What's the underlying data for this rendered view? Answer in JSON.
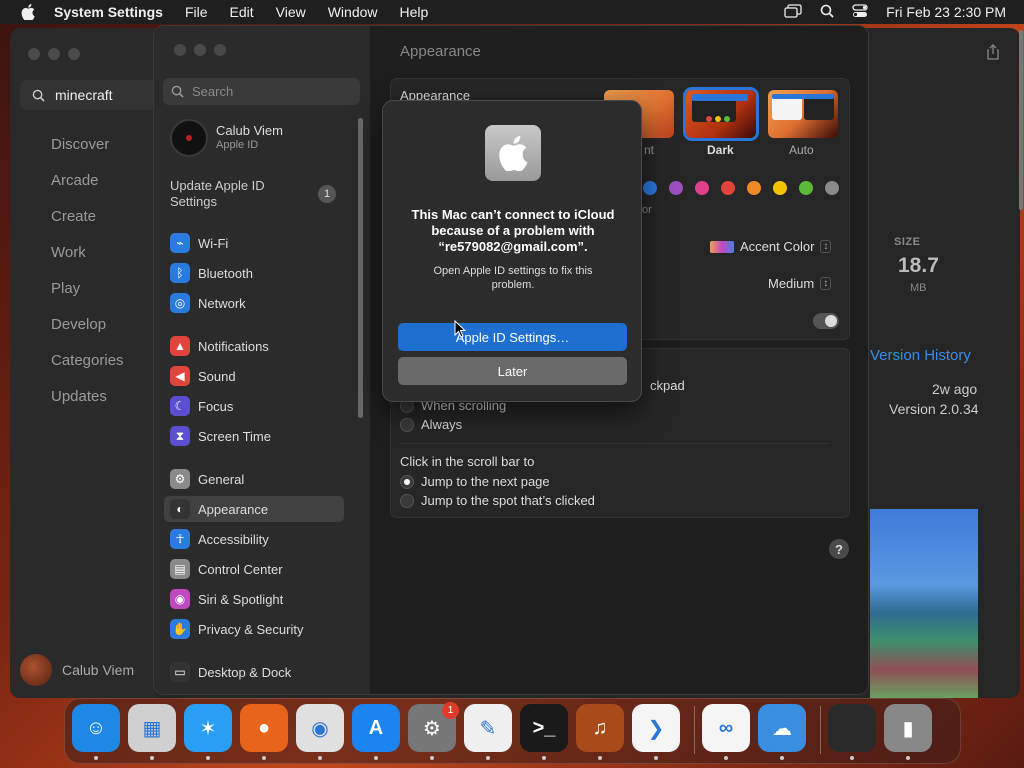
{
  "menubar": {
    "app_name": "System Settings",
    "menus": [
      "File",
      "Edit",
      "View",
      "Window",
      "Help"
    ],
    "datetime": "Fri Feb 23  2:30 PM"
  },
  "app_store": {
    "search_value": "minecraft",
    "nav": [
      "Discover",
      "Arcade",
      "Create",
      "Work",
      "Play",
      "Develop",
      "Categories",
      "Updates"
    ],
    "user_name": "Calub Viem",
    "size_label": "SIZE",
    "size_value": "18.7",
    "size_unit": "MB",
    "version_history": "Version History",
    "updated_ago": "2w ago",
    "version": "Version 2.0.34"
  },
  "settings": {
    "search_placeholder": "Search",
    "user": {
      "name": "Calub Viem",
      "subtitle": "Apple ID"
    },
    "update_prompt": "Update Apple ID Settings",
    "update_count": "1",
    "sidebar_groups": [
      [
        {
          "label": "Wi-Fi",
          "icon": "wifi-icon",
          "color": "#2a7be0"
        },
        {
          "label": "Bluetooth",
          "icon": "bluetooth-icon",
          "color": "#2a7be0"
        },
        {
          "label": "Network",
          "icon": "globe-icon",
          "color": "#2a7be0"
        }
      ],
      [
        {
          "label": "Notifications",
          "icon": "bell-icon",
          "color": "#e0443a"
        },
        {
          "label": "Sound",
          "icon": "speaker-icon",
          "color": "#e0443a"
        },
        {
          "label": "Focus",
          "icon": "moon-icon",
          "color": "#5a4fd0"
        },
        {
          "label": "Screen Time",
          "icon": "hourglass-icon",
          "color": "#5a4fd0"
        }
      ],
      [
        {
          "label": "General",
          "icon": "gear-icon",
          "color": "#8a8a8a"
        },
        {
          "label": "Appearance",
          "icon": "appearance-icon",
          "color": "#333333",
          "active": true
        },
        {
          "label": "Accessibility",
          "icon": "accessibility-icon",
          "color": "#2a7be0"
        },
        {
          "label": "Control Center",
          "icon": "control-center-icon",
          "color": "#8a8a8a"
        },
        {
          "label": "Siri & Spotlight",
          "icon": "siri-icon",
          "color": "#c048c0"
        },
        {
          "label": "Privacy & Security",
          "icon": "hand-icon",
          "color": "#2a7be0"
        }
      ],
      [
        {
          "label": "Desktop & Dock",
          "icon": "dock-icon",
          "color": "#333333"
        }
      ]
    ],
    "page_title": "Appearance",
    "appearance_label": "Appearance",
    "themes": [
      "Light",
      "Dark",
      "Auto"
    ],
    "selected_theme": "Dark",
    "accent_colors": [
      "#2a7be0",
      "#9b4fc0",
      "#e0408a",
      "#e0443a",
      "#f08a24",
      "#f2c200",
      "#5ab83a",
      "#8a8a8a"
    ],
    "highlight_value": "Accent Color",
    "sidebar_icon_size_value": "Medium",
    "scroll_option_fragment": "ckpad",
    "show_scroll_options": [
      "When scrolling",
      "Always"
    ],
    "click_scroll_label": "Click in the scroll bar to",
    "click_scroll_options": [
      "Jump to the next page",
      "Jump to the spot that’s clicked"
    ],
    "help_label": "?"
  },
  "dialog": {
    "title": "This Mac can’t connect to iCloud because of a problem with “re579082@gmail.com”.",
    "body": "Open Apple ID settings to fix this problem.",
    "primary_label": "Apple ID Settings…",
    "secondary_label": "Later",
    "light_partial": "nt",
    "accent_partial": "or"
  },
  "dock": {
    "items": [
      {
        "name": "finder",
        "color": "#1e88e5",
        "glyph": "☺"
      },
      {
        "name": "launchpad",
        "color": "#d0d0d0",
        "glyph": "▦"
      },
      {
        "name": "safari",
        "color": "#2a9df4",
        "glyph": "✶"
      },
      {
        "name": "firefox",
        "color": "#e8641b",
        "glyph": "●"
      },
      {
        "name": "chrome",
        "color": "#e0e0e0",
        "glyph": "◉"
      },
      {
        "name": "app-store",
        "color": "#1a84f0",
        "glyph": "A"
      },
      {
        "name": "system-settings",
        "color": "#777777",
        "glyph": "⚙",
        "badge": "1"
      },
      {
        "name": "textedit",
        "color": "#f0f0f0",
        "glyph": "✎"
      },
      {
        "name": "terminal",
        "color": "#1a1a1a",
        "glyph": ">_"
      },
      {
        "name": "garageband",
        "color": "#a84a1a",
        "glyph": "♫"
      },
      {
        "name": "vscode",
        "color": "#f5f5f5",
        "glyph": "❯"
      }
    ],
    "recents": [
      {
        "name": "visual-studio",
        "color": "#f5f5f5",
        "glyph": "∞"
      },
      {
        "name": "weather",
        "color": "#3a8ee0",
        "glyph": "☁"
      }
    ],
    "tail": [
      {
        "name": "minimized-window",
        "color": "#2a2a2a",
        "glyph": ""
      },
      {
        "name": "trash",
        "color": "#888888",
        "glyph": "▮"
      }
    ]
  }
}
